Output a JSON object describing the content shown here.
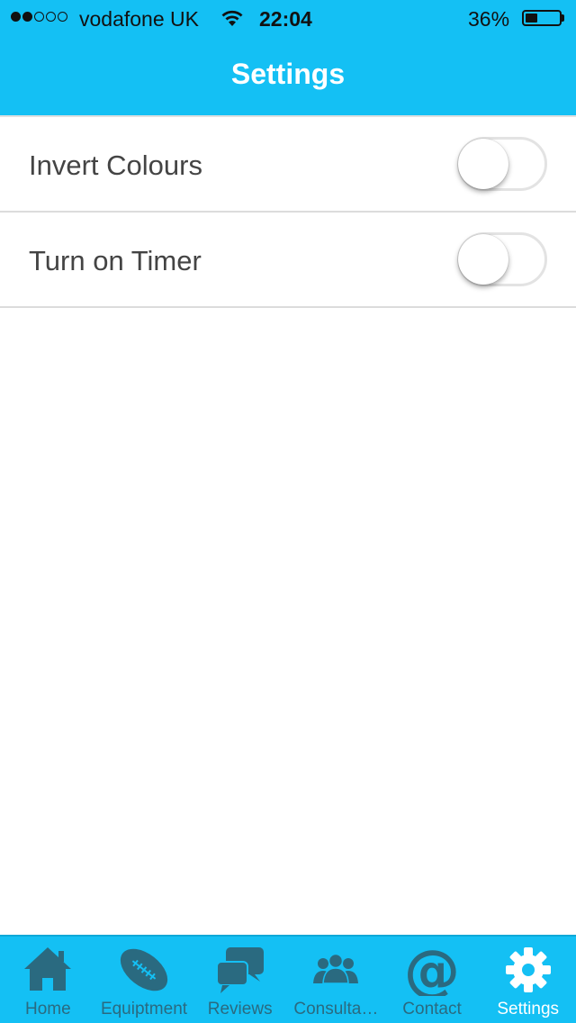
{
  "status_bar": {
    "signal_dots": [
      true,
      true,
      false,
      false,
      false
    ],
    "carrier": "vodafone UK",
    "time": "22:04",
    "battery_percent_text": "36%",
    "battery_level": 0.36
  },
  "nav": {
    "title": "Settings"
  },
  "settings": {
    "items": [
      {
        "label": "Invert Colours",
        "enabled": false
      },
      {
        "label": "Turn on Timer",
        "enabled": false
      }
    ]
  },
  "tab_bar": {
    "tabs": [
      {
        "label": "Home",
        "icon": "home-icon",
        "active": false
      },
      {
        "label": "Equiptment",
        "icon": "football-icon",
        "active": false
      },
      {
        "label": "Reviews",
        "icon": "chat-bubbles-icon",
        "active": false
      },
      {
        "label": "Consulta…",
        "icon": "people-icon",
        "active": false
      },
      {
        "label": "Contact",
        "icon": "at-sign-icon",
        "active": false
      },
      {
        "label": "Settings",
        "icon": "gear-icon",
        "active": true
      }
    ]
  },
  "colors": {
    "accent": "#14c0f4",
    "tab_inactive": "#2a6a80",
    "tab_active": "#ffffff"
  }
}
